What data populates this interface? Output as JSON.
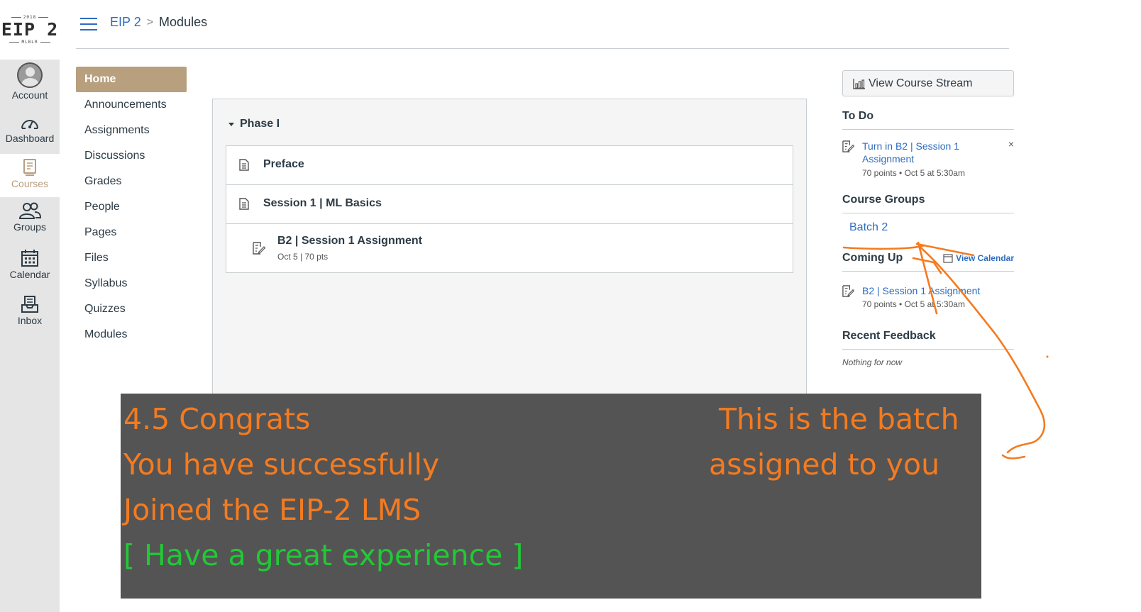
{
  "logo": {
    "year": "2018",
    "main": "EIP 2",
    "sub": "MLBLR"
  },
  "global_nav": [
    {
      "key": "account",
      "label": "Account"
    },
    {
      "key": "dashboard",
      "label": "Dashboard"
    },
    {
      "key": "courses",
      "label": "Courses"
    },
    {
      "key": "groups",
      "label": "Groups"
    },
    {
      "key": "calendar",
      "label": "Calendar"
    },
    {
      "key": "inbox",
      "label": "Inbox"
    }
  ],
  "breadcrumb": {
    "course": "EIP 2",
    "separator": ">",
    "current": "Modules"
  },
  "course_nav": [
    {
      "label": "Home",
      "active": true
    },
    {
      "label": "Announcements"
    },
    {
      "label": "Assignments"
    },
    {
      "label": "Discussions"
    },
    {
      "label": "Grades"
    },
    {
      "label": "People"
    },
    {
      "label": "Pages"
    },
    {
      "label": "Files"
    },
    {
      "label": "Syllabus"
    },
    {
      "label": "Quizzes"
    },
    {
      "label": "Modules"
    }
  ],
  "modules": {
    "title": "Phase I",
    "items": [
      {
        "title": "Preface",
        "icon": "page-icon"
      },
      {
        "title": "Session 1 | ML Basics",
        "icon": "page-icon"
      },
      {
        "title": "B2 | Session 1 Assignment",
        "meta": "Oct 5  |  70 pts",
        "icon": "assignment-icon"
      }
    ]
  },
  "sidebar": {
    "stream_button": "View Course Stream",
    "todo": {
      "heading": "To Do",
      "item_title": "Turn in B2 | Session 1 Assignment",
      "item_meta": "70 points • Oct 5 at 5:30am",
      "dismiss": "×"
    },
    "groups": {
      "heading": "Course Groups",
      "item": "Batch 2"
    },
    "coming_up": {
      "heading": "Coming Up",
      "view_calendar": "View Calendar",
      "item_title": "B2 | Session 1 Assignment",
      "item_meta": "70 points • Oct 5 at 5:30am"
    },
    "feedback": {
      "heading": "Recent Feedback",
      "empty": "Nothing for now"
    }
  },
  "annotation": {
    "line1": "4.5  Congrats",
    "line2": "You have successfully",
    "line3": "Joined the EIP-2 LMS",
    "line4": "[ Have a great experience ]",
    "right1": "This is the batch",
    "right2": "assigned to you"
  },
  "colors": {
    "brand": "#b89f7e",
    "link": "#2d6cc0",
    "annotation_orange": "#f47b20",
    "annotation_green": "#22c936",
    "overlay_bg": "#545454"
  }
}
